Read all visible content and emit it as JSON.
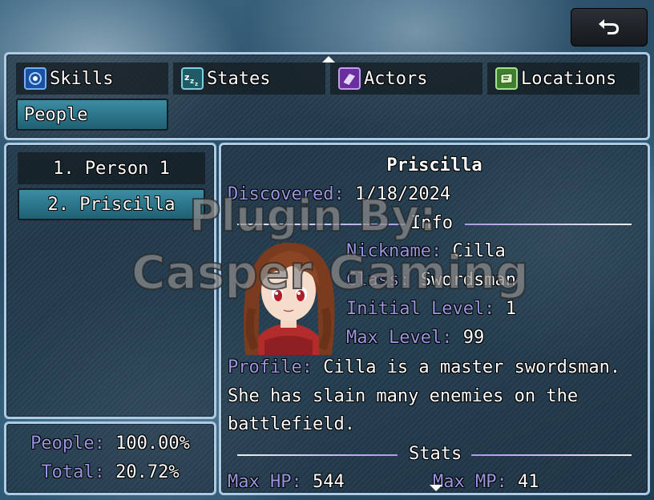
{
  "back_button": {
    "icon": "return-arrow-icon"
  },
  "categories": [
    {
      "label": "Skills",
      "icon": "skills-icon",
      "color": "#2a6fd0"
    },
    {
      "label": "States",
      "icon": "states-icon",
      "color": "#2a8a96"
    },
    {
      "label": "Actors",
      "icon": "actors-icon",
      "color": "#7b3fb0"
    },
    {
      "label": "Locations",
      "icon": "locations-icon",
      "color": "#4f9a3a"
    },
    {
      "label": "People",
      "selected": true
    }
  ],
  "people_list": [
    {
      "label": "1. Person 1"
    },
    {
      "label": "2. Priscilla",
      "selected": true
    }
  ],
  "completion": {
    "people_label": "People:",
    "people_value": "100.00%",
    "total_label": "Total:",
    "total_value": "20.72%"
  },
  "detail": {
    "name": "Priscilla",
    "discovered_label": "Discovered:",
    "discovered_value": "1/18/2024",
    "info_heading": "Info",
    "nickname_label": "Nickname:",
    "nickname_value": "Cilla",
    "class_label": "Class:",
    "class_value": "Swordsman",
    "initial_level_label": "Initial Level:",
    "initial_level_value": "1",
    "max_level_label": "Max Level:",
    "max_level_value": "99",
    "profile_label": "Profile:",
    "profile_line1": "Cilla is a master swordsman.",
    "profile_line2": "She has slain many enemies on the",
    "profile_line3": "battlefield.",
    "stats_heading": "Stats",
    "max_hp_label": "Max HP:",
    "max_hp_value": "544",
    "max_mp_label": "Max MP:",
    "max_mp_value": "41"
  },
  "watermark": {
    "line1": "Plugin By:",
    "line2": "Casper Gaming"
  },
  "colors": {
    "system_text": "#9a96e0",
    "selection": "#2f7f95",
    "window_border": "#aecbe6"
  }
}
